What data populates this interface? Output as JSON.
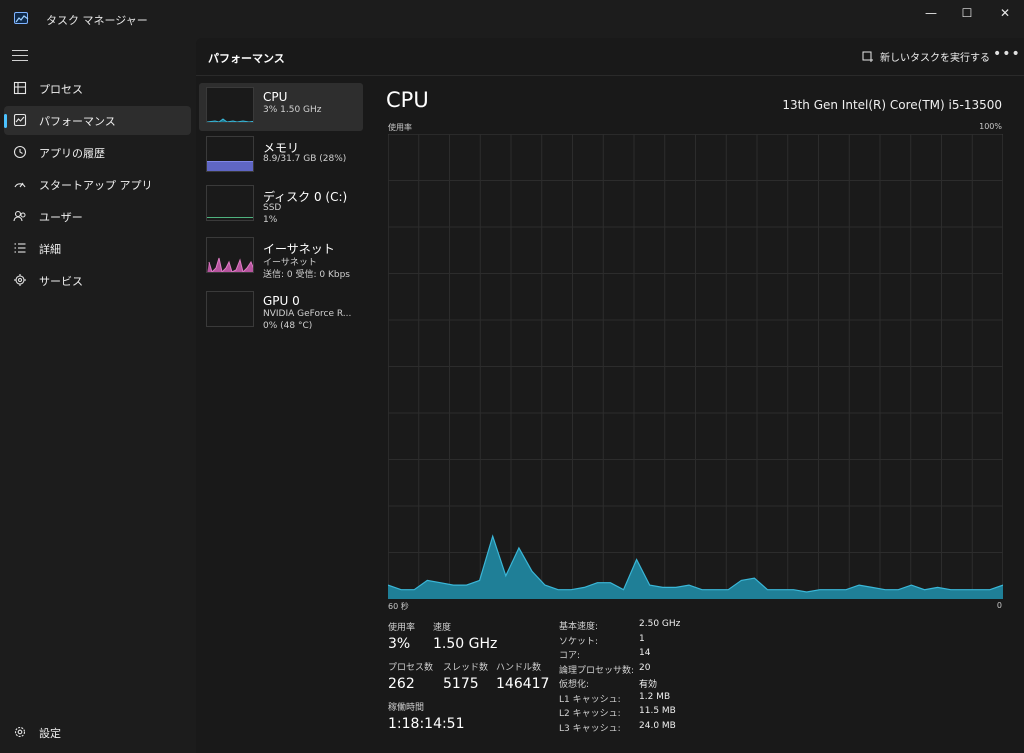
{
  "app": {
    "title": "タスク マネージャー"
  },
  "window": {
    "minimize": "—",
    "maximize": "☐",
    "close": "✕"
  },
  "sidebar": {
    "items": [
      {
        "label": "プロセス",
        "icon": "processes-icon"
      },
      {
        "label": "パフォーマンス",
        "icon": "performance-icon",
        "active": true
      },
      {
        "label": "アプリの履歴",
        "icon": "app-history-icon"
      },
      {
        "label": "スタートアップ アプリ",
        "icon": "startup-icon"
      },
      {
        "label": "ユーザー",
        "icon": "users-icon"
      },
      {
        "label": "詳細",
        "icon": "details-icon"
      },
      {
        "label": "サービス",
        "icon": "services-icon"
      }
    ],
    "settings_label": "設定"
  },
  "header": {
    "title": "パフォーマンス",
    "run_task_label": "新しいタスクを実行する",
    "more_label": "•••"
  },
  "devices": [
    {
      "name": "CPU",
      "line1": "3%  1.50 GHz",
      "line2": ""
    },
    {
      "name": "メモリ",
      "line1": "8.9/31.7 GB (28%)",
      "line2": ""
    },
    {
      "name": "ディスク 0 (C:)",
      "line1": "SSD",
      "line2": "1%"
    },
    {
      "name": "イーサネット",
      "line1": "イーサネット",
      "line2": "送信: 0 受信: 0 Kbps"
    },
    {
      "name": "GPU 0",
      "line1": "NVIDIA GeForce R...",
      "line2": "0%  (48 °C)"
    }
  ],
  "cpu": {
    "title": "CPU",
    "model": "13th Gen Intel(R) Core(TM) i5-13500",
    "usage_label": "使用率",
    "max_label": "100%",
    "time_left": "60 秒",
    "time_right": "0",
    "stats": {
      "usage_label": "使用率",
      "usage": "3%",
      "speed_label": "速度",
      "speed": "1.50 GHz",
      "processes_label": "プロセス数",
      "processes": "262",
      "threads_label": "スレッド数",
      "threads": "5175",
      "handles_label": "ハンドル数",
      "handles": "146417",
      "uptime_label": "稼働時間",
      "uptime": "1:18:14:51"
    },
    "specs": [
      {
        "k": "基本速度:",
        "v": "2.50 GHz"
      },
      {
        "k": "ソケット:",
        "v": "1"
      },
      {
        "k": "コア:",
        "v": "14"
      },
      {
        "k": "論理プロセッサ数:",
        "v": "20"
      },
      {
        "k": "仮想化:",
        "v": "有効"
      },
      {
        "k": "L1 キャッシュ:",
        "v": "1.2 MB"
      },
      {
        "k": "L2 キャッシュ:",
        "v": "11.5 MB"
      },
      {
        "k": "L3 キャッシュ:",
        "v": "24.0 MB"
      }
    ]
  },
  "colors": {
    "accent": "#4cc2ff",
    "cpu_line": "#3ab7d8",
    "cpu_fill": "#1f7f97",
    "memory": "#7f86e8",
    "disk": "#4fb37f",
    "ethernet": "#e07cc6"
  },
  "chart_data": {
    "type": "area",
    "y_range": [
      0,
      100
    ],
    "x_range": [
      60,
      0
    ],
    "values": [
      3,
      2,
      2,
      4,
      3.5,
      3,
      3,
      4,
      13.5,
      5,
      11,
      6,
      3,
      2,
      2,
      2.5,
      3.5,
      3.5,
      2,
      8.5,
      3,
      2.5,
      2.5,
      3,
      2,
      2,
      2,
      4,
      4.5,
      2,
      2,
      2,
      1.5,
      2,
      2,
      2,
      3,
      2.5,
      2,
      2,
      3,
      2,
      2.5,
      2,
      2,
      2,
      2,
      3
    ]
  }
}
